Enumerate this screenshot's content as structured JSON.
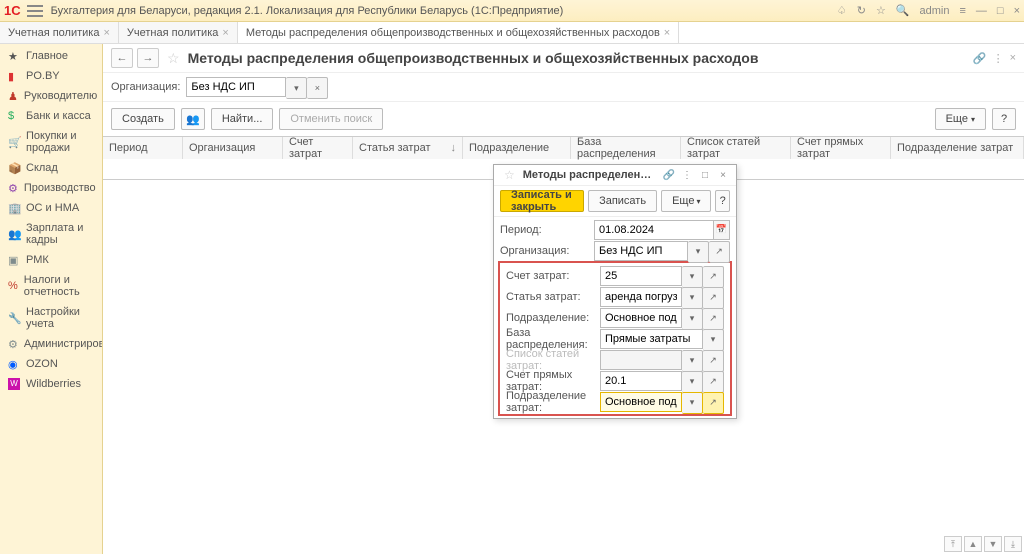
{
  "titlebar": {
    "app_title": "Бухгалтерия для Беларуси, редакция 2.1. Локализация для Республики Беларусь  (1С:Предприятие)",
    "user": "admin"
  },
  "tabs": [
    {
      "label": "Учетная политика"
    },
    {
      "label": "Учетная политика"
    },
    {
      "label": "Методы распределения общепроизводственных и общехозяйственных расходов",
      "active": true
    }
  ],
  "sidebar": {
    "items": [
      "Главное",
      "PO.BY",
      "Руководителю",
      "Банк и касса",
      "Покупки и продажи",
      "Склад",
      "Производство",
      "ОС и НМА",
      "Зарплата и кадры",
      "РМК",
      "Налоги и отчетность",
      "Настройки учета",
      "Администрирование",
      "OZON",
      "Wildberries"
    ]
  },
  "page": {
    "title": "Методы распределения общепроизводственных и общехозяйственных расходов",
    "org_label": "Организация:",
    "org_value": "Без НДС ИП",
    "toolbar": {
      "create": "Создать",
      "find": "Найти...",
      "cancel_find": "Отменить поиск",
      "more": "Еще",
      "help": "?"
    },
    "grid_cols": [
      "Период",
      "Организация",
      "Счет затрат",
      "Статья затрат",
      "Подразделение",
      "База распределения",
      "Список статей затрат",
      "Счет прямых затрат",
      "Подразделение затрат"
    ]
  },
  "dialog": {
    "title": "Методы распределения обще…",
    "toolbar": {
      "save_close": "Записать и закрыть",
      "save": "Записать",
      "more": "Еще",
      "help": "?"
    },
    "fields": {
      "period_label": "Период:",
      "period_value": "01.08.2024",
      "org_label": "Организация:",
      "org_value": "Без НДС ИП",
      "acc_label": "Счет затрат:",
      "acc_value": "25",
      "item_label": "Статья затрат:",
      "item_value": "аренда погрузчика",
      "dept_label": "Подразделение:",
      "dept_value": "Основное подразделение",
      "base_label": "База распределения:",
      "base_value": "Прямые затраты",
      "list_label": "Список статей затрат:",
      "list_value": "",
      "direct_label": "Счет прямых затрат:",
      "direct_value": "20.1",
      "costdept_label": "Подразделение затрат:",
      "costdept_value": "Основное подразделение"
    }
  }
}
